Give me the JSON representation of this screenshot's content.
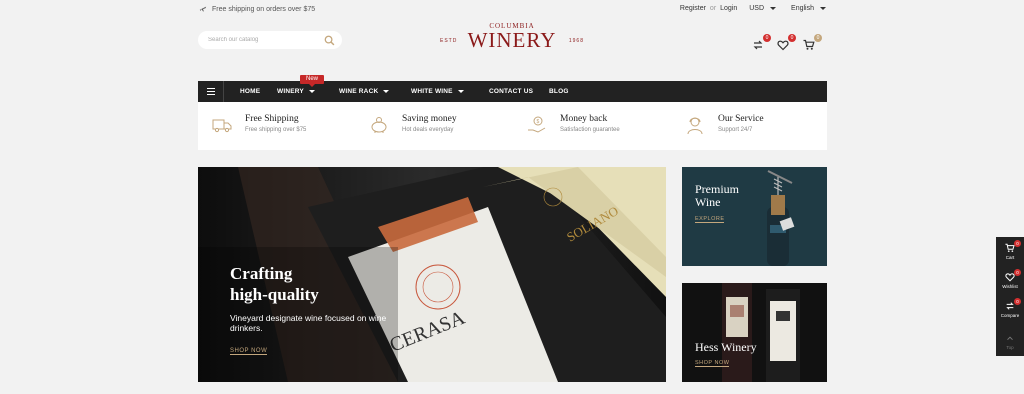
{
  "topbar": {
    "shipping_note": "Free shipping on orders over $75",
    "register": "Register",
    "or": "or",
    "login": "Login",
    "currency": "USD",
    "language": "English"
  },
  "search": {
    "placeholder": "Search our catalog"
  },
  "logo": {
    "top": "COLUMBIA",
    "name": "WINERY",
    "estd": "ESTD",
    "year": "1968"
  },
  "header_icons": [
    {
      "icon": "compare-icon",
      "count": "0"
    },
    {
      "icon": "heart-icon",
      "count": "0"
    },
    {
      "icon": "cart-icon",
      "count": "0"
    }
  ],
  "nav": {
    "new_badge": "New",
    "items": [
      {
        "label": "HOME"
      },
      {
        "label": "WINERY"
      },
      {
        "label": "WINE RACK"
      },
      {
        "label": "WHITE WINE"
      },
      {
        "label": "CONTACT US"
      },
      {
        "label": "BLOG"
      }
    ]
  },
  "features": [
    {
      "icon": "truck-icon",
      "title": "Free Shipping",
      "subtitle": "Free shipping over $75"
    },
    {
      "icon": "piggy-bank-icon",
      "title": "Saving money",
      "subtitle": "Hot deals everyday"
    },
    {
      "icon": "money-hand-icon",
      "title": "Money back",
      "subtitle": "Satisfaction guarantee"
    },
    {
      "icon": "support-agent-icon",
      "title": "Our Service",
      "subtitle": "Support 24/7"
    }
  ],
  "hero": {
    "title_line1": "Crafting",
    "title_line2": "high-quality",
    "description": "Vineyard designate wine focused on wine drinkers.",
    "link": "SHOP NOW",
    "bottle1_label": "CERASA",
    "bottle2_label": "SOLIANO"
  },
  "promo1": {
    "line1": "Premium",
    "line2": "Wine",
    "link": "EXPLORE"
  },
  "promo2": {
    "title": "Hess Winery",
    "link": "SHOP NOW"
  },
  "side_panel": {
    "cart_label": "Cart",
    "cart_count": "0",
    "wishlist_label": "Wishlist",
    "wishlist_count": "0",
    "compare_label": "Compare",
    "compare_count": "0",
    "top_label": "Top"
  },
  "colors": {
    "brand": "#8b1a1a",
    "accent": "#c4a77d",
    "nav_bg": "#222222",
    "badge": "#d32f2f"
  }
}
